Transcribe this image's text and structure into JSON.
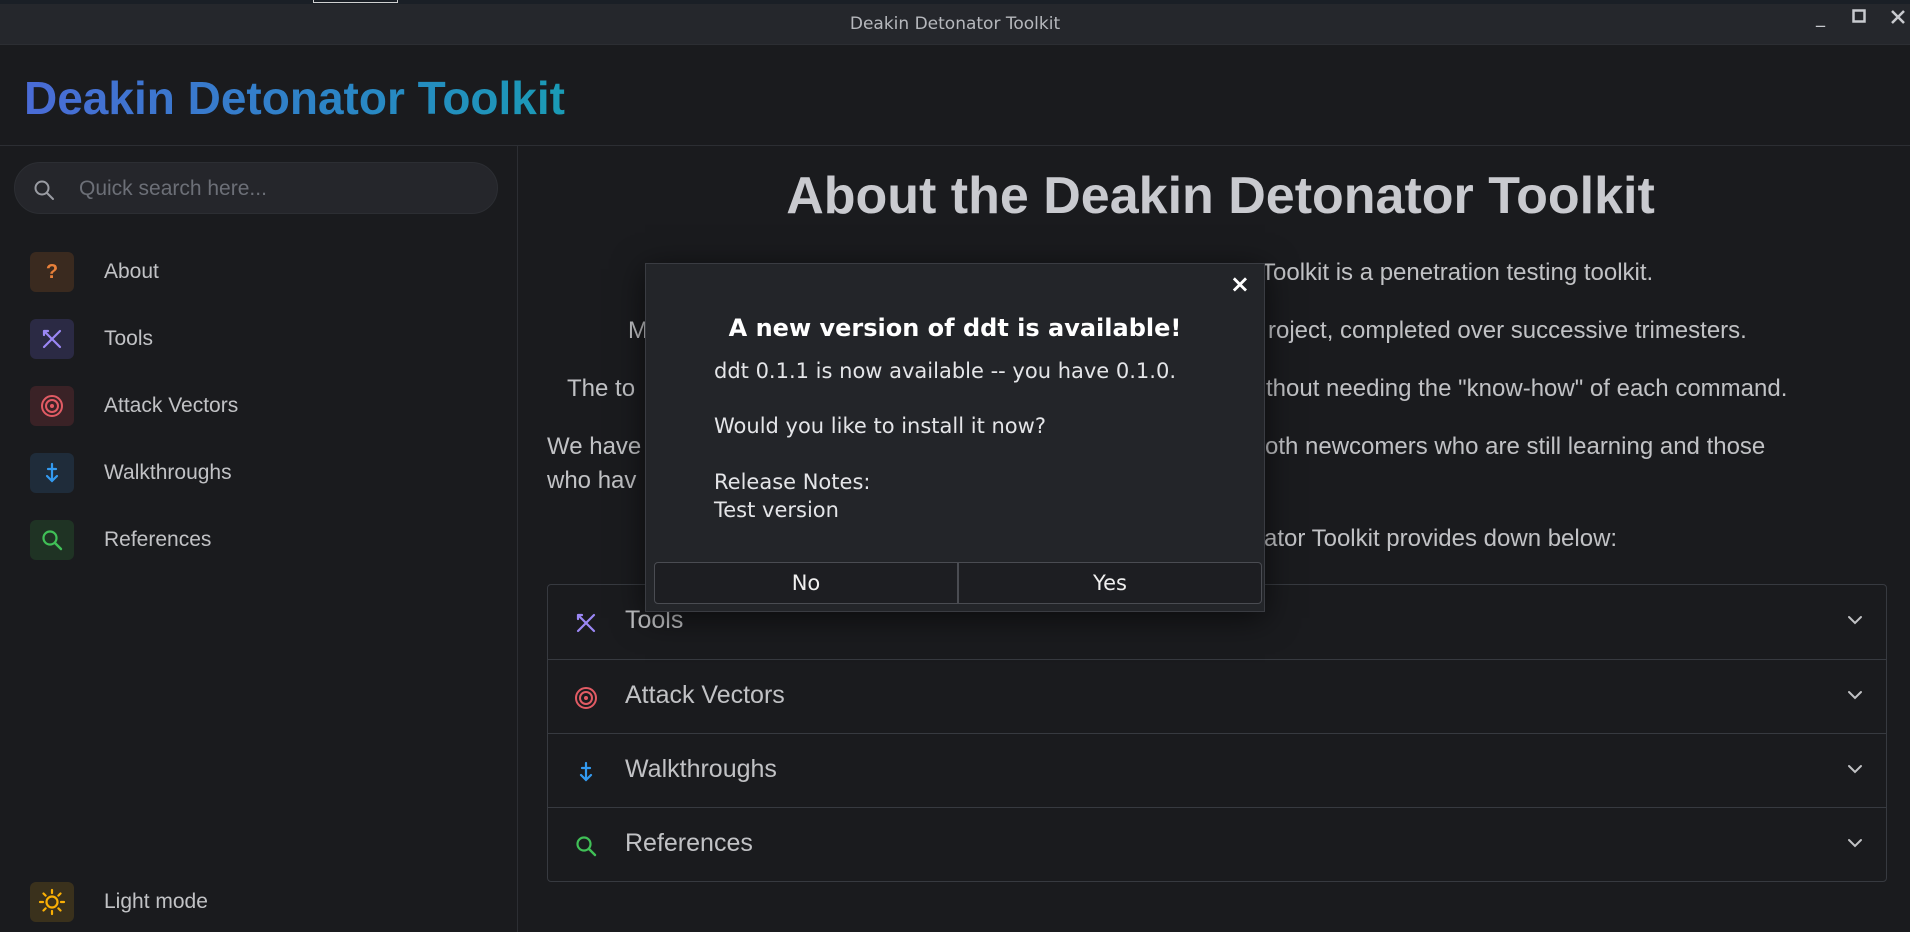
{
  "window": {
    "title": "Deakin Detonator Toolkit"
  },
  "header": {
    "brand": "Deakin Detonator Toolkit"
  },
  "sidebar": {
    "search_placeholder": "Quick search here...",
    "items": [
      {
        "label": "About",
        "icon": "question-icon",
        "color": "#e8803a",
        "bg": "#3a2a1f"
      },
      {
        "label": "Tools",
        "icon": "tools-icon",
        "color": "#9b87f5",
        "bg": "#2b2a44"
      },
      {
        "label": "Attack Vectors",
        "icon": "target-icon",
        "color": "#e15b64",
        "bg": "#3a2226"
      },
      {
        "label": "Walkthroughs",
        "icon": "arrow-down-icon",
        "color": "#339af0",
        "bg": "#1f2c3a"
      },
      {
        "label": "References",
        "icon": "search-icon",
        "color": "#40c057",
        "bg": "#1f3324"
      }
    ],
    "theme_toggle": {
      "label": "Light mode",
      "icon": "sun-icon",
      "color": "#fab005",
      "bg": "#3a311c"
    }
  },
  "main": {
    "title": "About the Deakin Detonator Toolkit",
    "paragraphs": [
      "Toolkit is a penetration testing toolkit.",
      "M",
      "roject, completed over successive trimesters.",
      "The to",
      "thout needing the \"know-how\" of each command.",
      "We have",
      "oth newcomers who are still learning and those",
      "who hav",
      "ator Toolkit provides down below:"
    ],
    "accordion": [
      {
        "label": "Tools",
        "icon": "tools-icon",
        "color": "#9b87f5"
      },
      {
        "label": "Attack Vectors",
        "icon": "target-icon",
        "color": "#e15b64"
      },
      {
        "label": "Walkthroughs",
        "icon": "arrow-down-icon",
        "color": "#339af0"
      },
      {
        "label": "References",
        "icon": "search-icon",
        "color": "#40c057"
      }
    ]
  },
  "modal": {
    "close_glyph": "×",
    "title": "A new version of ddt is available!",
    "version_line": "ddt 0.1.1 is now available -- you have 0.1.0.",
    "question": "Would you like to install it now?",
    "notes_label": "Release Notes:",
    "notes_text": "Test version",
    "no_label": "No",
    "yes_label": "Yes"
  }
}
